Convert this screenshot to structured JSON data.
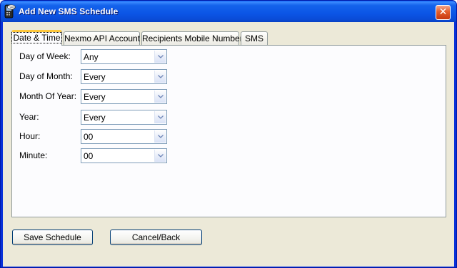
{
  "window": {
    "title": "Add New SMS Schedule",
    "close_glyph": "✕",
    "icon": "sms-phone-icon"
  },
  "tabs": [
    {
      "label": "Date & Time",
      "active": true
    },
    {
      "label": "Nexmo API Account",
      "active": false
    },
    {
      "label": "Recipients Mobile Numbers",
      "active": false
    },
    {
      "label": "SMS",
      "active": false
    }
  ],
  "form": {
    "fields": [
      {
        "label": "Day of Week:",
        "value": "Any"
      },
      {
        "label": "Day of Month:",
        "value": "Every"
      },
      {
        "label": "Month Of Year:",
        "value": "Every"
      },
      {
        "label": "Year:",
        "value": "Every"
      },
      {
        "label": "Hour:",
        "value": "00"
      },
      {
        "label": "Minute:",
        "value": "00"
      }
    ]
  },
  "buttons": {
    "save": "Save Schedule",
    "cancel": "Cancel/Back"
  },
  "colors": {
    "title_bar": "#0b55e6",
    "face": "#ece9d8",
    "active_tab_accent": "#ffc83c",
    "close_button": "#e35d2a"
  }
}
